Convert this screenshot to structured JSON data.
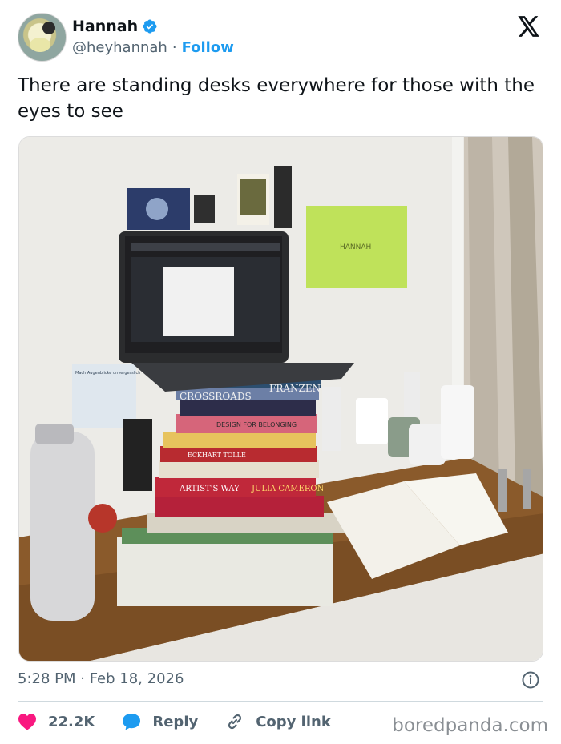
{
  "author": {
    "display_name": "Hannah",
    "handle": "@heyhannah",
    "separator": "·",
    "follow_label": "Follow"
  },
  "post": {
    "text": "There are standing desks everywhere for those with the eyes to see",
    "timestamp": "5:28 PM · Feb 18, 2026"
  },
  "photo": {
    "book_titles": [
      "CROSSROADS",
      "FRANZEN",
      "DESIGN FOR BELONGING",
      "ECKHART TOLLE",
      "ARTIST'S WAY",
      "JULIA CAMERON"
    ],
    "note_text": "HANNAH",
    "poster_text": "Mach Augenblicke unvergesslich"
  },
  "actions": {
    "likes_count": "22.2K",
    "reply_label": "Reply",
    "copy_link_label": "Copy link"
  },
  "brand": {
    "watermark": "boredpanda.com"
  },
  "colors": {
    "accent": "#1d9bf0",
    "like": "#f91880",
    "muted": "#536471"
  }
}
